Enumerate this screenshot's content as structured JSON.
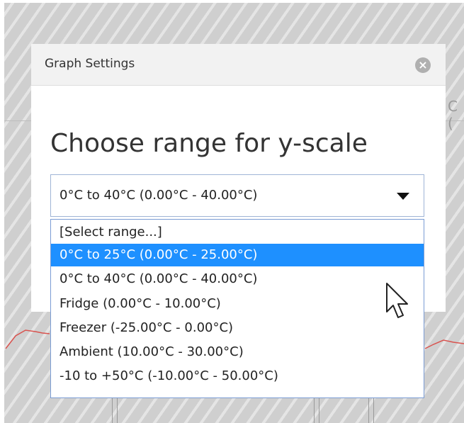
{
  "dialog": {
    "title": "Graph Settings",
    "close_icon": "close-circle-icon",
    "heading": "Choose range for y-scale"
  },
  "select": {
    "current_value": "0°C to 40°C (0.00°C - 40.00°C)",
    "arrow_icon": "dropdown-arrow-icon",
    "options": [
      "[Select range...]",
      "0°C to 25°C (0.00°C - 25.00°C)",
      "0°C to 40°C (0.00°C - 40.00°C)",
      "Fridge (0.00°C - 10.00°C)",
      "Freezer (-25.00°C - 0.00°C)",
      "Ambient (10.00°C - 30.00°C)",
      "-10 to +50°C (-10.00°C - 50.00°C)"
    ],
    "highlighted_index": 1
  },
  "background": {
    "partial_text": "C (",
    "line_color": "#d9534f"
  },
  "colors": {
    "highlight": "#1e90ff",
    "select_border": "#9fb4d6"
  }
}
